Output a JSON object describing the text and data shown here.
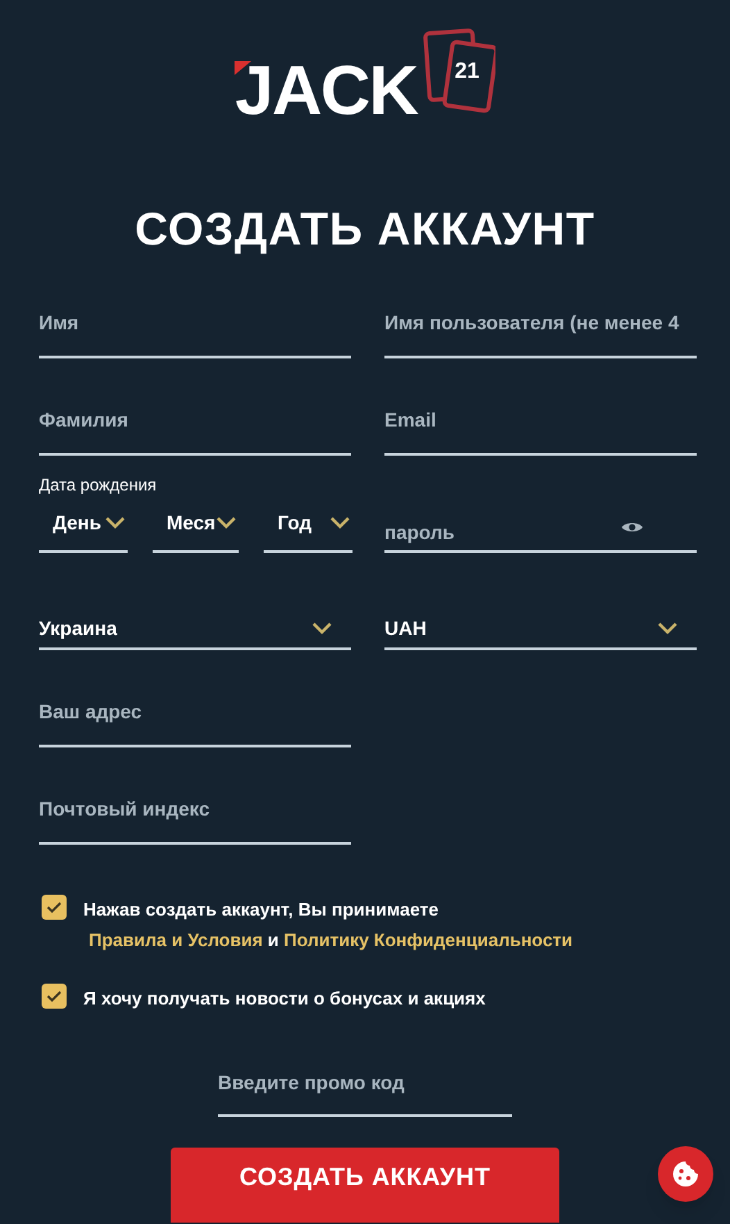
{
  "logo": {
    "word": "JACK",
    "number": "21"
  },
  "title": "СОЗДАТЬ АККАУНТ",
  "fields": [
    {
      "kind": "input",
      "placeholder": "Имя"
    },
    {
      "kind": "input",
      "placeholder": "Имя пользователя (не менее 4"
    },
    {
      "kind": "input",
      "placeholder": "Фамилия"
    },
    {
      "kind": "input",
      "placeholder": "Email"
    },
    {
      "kind": "date",
      "label": "Дата рождения",
      "parts": [
        "День",
        "Меся",
        "Год"
      ]
    },
    {
      "kind": "password",
      "placeholder": "пароль"
    },
    {
      "kind": "select",
      "value": "Украина"
    },
    {
      "kind": "select",
      "value": "UAH"
    },
    {
      "kind": "input",
      "placeholder": "Ваш адрес"
    },
    {
      "kind": "spacer"
    },
    {
      "kind": "input",
      "placeholder": "Почтовый индекс"
    }
  ],
  "consents": [
    {
      "checked": true,
      "text": "Нажав создать аккаунт, Вы принимаете",
      "link_1": "Правила и Условия",
      "joiner": "и",
      "link_2": "Политику Конфиденциальности"
    },
    {
      "checked": true,
      "text": "Я хочу получать новости о бонусах и акциях"
    }
  ],
  "promo": {
    "placeholder": "Введите промо код"
  },
  "submit": "СОЗДАТЬ АККАУНТ"
}
